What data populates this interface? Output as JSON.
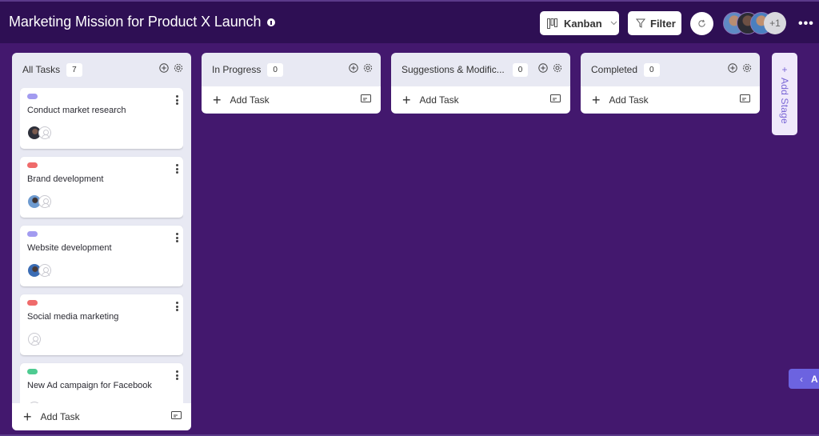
{
  "header": {
    "title": "Marketing Mission for Product X Launch",
    "view_button": {
      "label": "Kanban",
      "icon": "kanban-icon"
    },
    "filter_button": {
      "label": "Filter",
      "icon": "filter-icon"
    },
    "refresh_icon": "refresh-icon",
    "members_extra": "+1",
    "more_label": "•••"
  },
  "columns": [
    {
      "title": "All Tasks",
      "count": "7",
      "add_task_label": "Add Task",
      "cards": [
        {
          "title": "Conduct market research",
          "tag_color": "#a29bf0"
        },
        {
          "title": "Brand development",
          "tag_color": "#ef6b6b"
        },
        {
          "title": "Website development",
          "tag_color": "#a29bf0"
        },
        {
          "title": "Social media marketing",
          "tag_color": "#ef6b6b"
        },
        {
          "title": "New Ad campaign for Facebook",
          "tag_color": "#4ecb91"
        }
      ]
    },
    {
      "title": "In Progress",
      "count": "0",
      "add_task_label": "Add Task"
    },
    {
      "title": "Suggestions & Modific...",
      "count": "0",
      "add_task_label": "Add Task"
    },
    {
      "title": "Completed",
      "count": "0",
      "add_task_label": "Add Task"
    }
  ],
  "add_stage": {
    "plus": "+",
    "label": "Add Stage"
  },
  "collapse_tab": {
    "chevron": "‹",
    "label": "A"
  },
  "colors": {
    "background": "#43186e",
    "topbar": "#2e0f54",
    "accent": "#6c63e0",
    "column_bg": "#e8e9f3"
  }
}
